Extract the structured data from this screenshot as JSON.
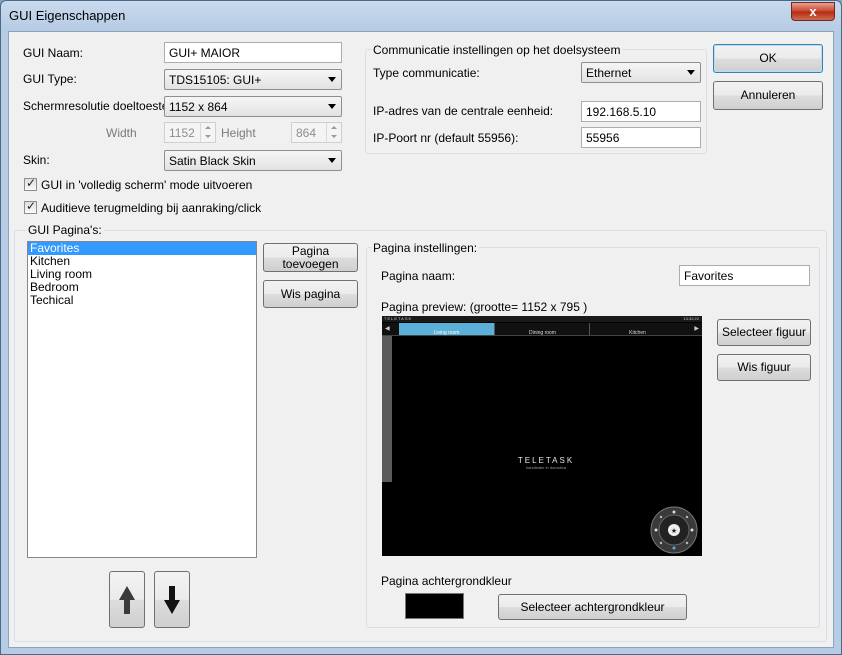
{
  "window": {
    "title": "GUI Eigenschappen",
    "close_glyph": "x"
  },
  "gui": {
    "name_label": "GUI Naam:",
    "name_value": "GUI+ MAIOR",
    "type_label": "GUI Type:",
    "type_value": "TDS15105: GUI+",
    "resolution_label": "Schermresolutie doeltoestel:",
    "resolution_value": "1152 x 864",
    "width_label": "Width",
    "width_value": "1152",
    "height_label": "Height",
    "height_value": "864",
    "skin_label": "Skin:",
    "skin_value": "Satin Black Skin",
    "fullscreen_label": "GUI in 'volledig scherm' mode uitvoeren",
    "fullscreen_checked": true,
    "audio_label": "Auditieve terugmelding bij aanraking/click",
    "audio_checked": true
  },
  "comm": {
    "group_title": "Communicatie instellingen op het doelsysteem",
    "type_label": "Type communicatie:",
    "type_value": "Ethernet",
    "ip_label": "IP-adres van de centrale eenheid:",
    "ip_value": "192.168.5.10",
    "port_label": "IP-Poort nr (default 55956):",
    "port_value": "55956"
  },
  "dialog_buttons": {
    "ok": "OK",
    "cancel": "Annuleren"
  },
  "pages": {
    "group_title": "GUI Pagina's:",
    "items": [
      "Favorites",
      "Kitchen",
      "Living room",
      "Bedroom",
      "Techical"
    ],
    "selected_index": 0,
    "add_button": "Pagina toevoegen",
    "delete_button": "Wis pagina"
  },
  "page_settings": {
    "group_title": "Pagina instellingen:",
    "name_label": "Pagina naam:",
    "name_value": "Favorites",
    "preview_label": "Pagina preview: (grootte= 1152 x 795 )",
    "select_image_button": "Selecteer figuur",
    "delete_image_button": "Wis figuur",
    "bg_color_label": "Pagina achtergrondkleur",
    "bg_color": "#000000",
    "select_bg_button": "Selecteer achtergrondkleur"
  },
  "preview": {
    "brand": "TELETASK",
    "time": "13:32:22",
    "tabs": [
      "Living room",
      "Dining room",
      "Kitchen"
    ],
    "active_tab": 0,
    "logo": "TELETASK",
    "tagline": "handleider in domotica",
    "accent": "#5ab0d8"
  }
}
